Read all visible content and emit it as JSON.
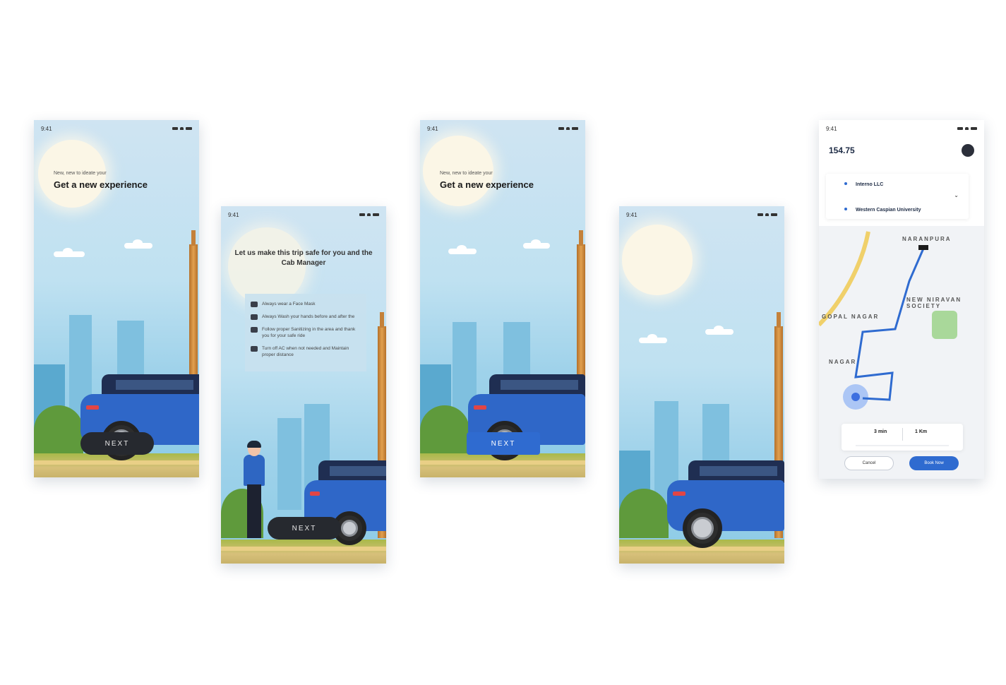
{
  "status_time": "9:41",
  "screen1": {
    "subtitle": "New, new to ideate your",
    "title": "Get a new experience",
    "next_label": "NEXT"
  },
  "screen2": {
    "title": "Let us make this trip safe for you and the Cab Manager",
    "features": [
      {
        "icon": "mask-icon",
        "text": "Always wear a Face Mask"
      },
      {
        "icon": "distance-icon",
        "text": "Always Wash your hands before and after the"
      },
      {
        "icon": "sanitize-icon",
        "text": "Follow proper Sanitizing in the area and thank you for your safe ride"
      },
      {
        "icon": "car-icon",
        "text": "Turn off AC when not needed and Maintain proper distance"
      }
    ],
    "next_label": "NEXT"
  },
  "screen3": {
    "subtitle": "New, new to ideate your",
    "title": "Get a new experience",
    "next_label": "NEXT"
  },
  "screen5": {
    "fare": "154.75",
    "pickup": "Interno LLC",
    "destination": "Western Caspian University",
    "map_labels": [
      "NARANPURA",
      "NEW NIRAVAN SOCIETY",
      "GOPAL NAGAR",
      "NAGAR"
    ],
    "time": "3 min",
    "distance": "1 Km",
    "cancel_label": "Cancel",
    "book_label": "Book Now"
  },
  "colors": {
    "accent_blue": "#2f6bd0",
    "dark_button": "#26292f",
    "car_blue": "#2f67c8"
  }
}
